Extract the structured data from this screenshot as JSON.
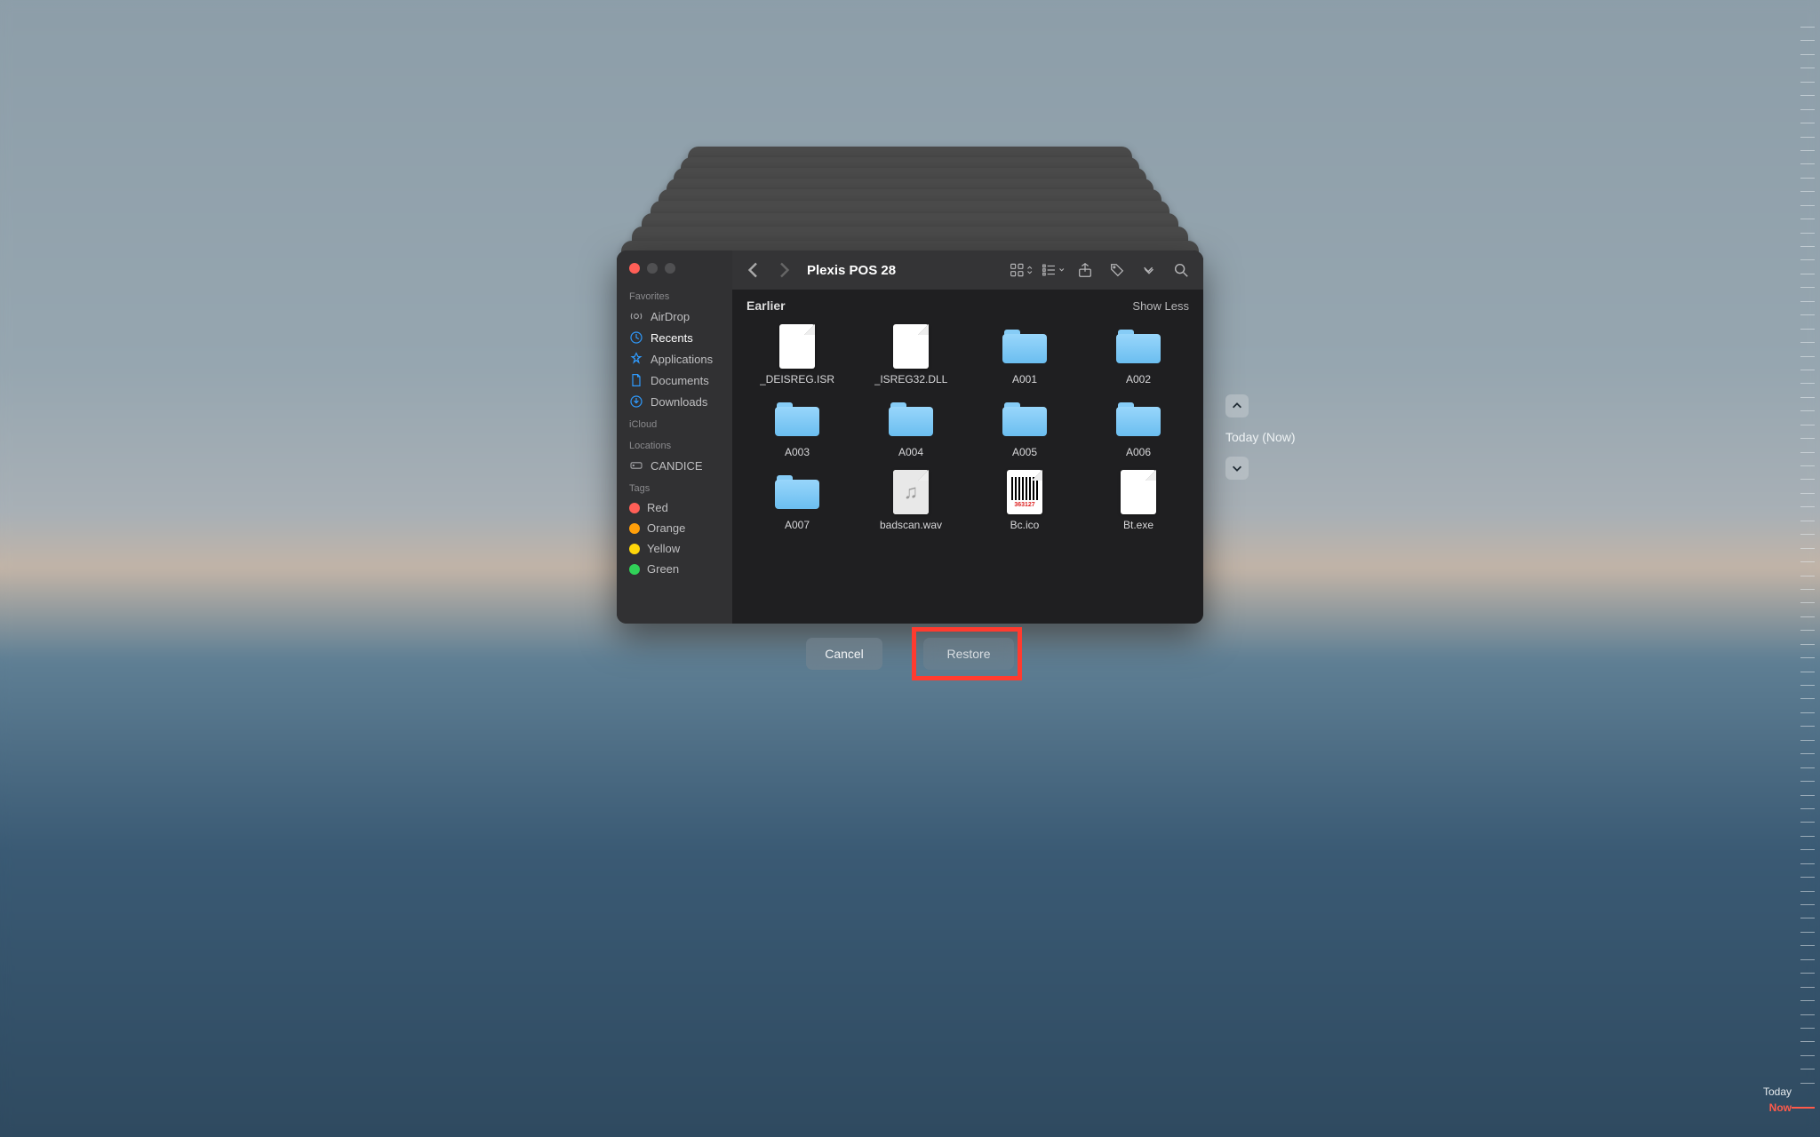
{
  "window": {
    "title": "Plexis POS 28"
  },
  "sidebar": {
    "sections": {
      "favorites": "Favorites",
      "icloud": "iCloud",
      "locations": "Locations",
      "tags": "Tags"
    },
    "favorites": [
      {
        "label": "AirDrop",
        "icon": "airdrop"
      },
      {
        "label": "Recents",
        "icon": "clock",
        "selected": true
      },
      {
        "label": "Applications",
        "icon": "apps"
      },
      {
        "label": "Documents",
        "icon": "doc"
      },
      {
        "label": "Downloads",
        "icon": "download"
      }
    ],
    "locations": [
      {
        "label": "CANDICE",
        "icon": "disk"
      }
    ],
    "tags": [
      {
        "label": "Red",
        "color": "#ff5f57"
      },
      {
        "label": "Orange",
        "color": "#ff9f0a"
      },
      {
        "label": "Yellow",
        "color": "#ffd60a"
      },
      {
        "label": "Green",
        "color": "#30d158"
      }
    ]
  },
  "content": {
    "section_title": "Earlier",
    "show_less": "Show Less",
    "files": [
      {
        "name": "_DEISREG.ISR",
        "kind": "doc"
      },
      {
        "name": "_ISREG32.DLL",
        "kind": "doc"
      },
      {
        "name": "A001",
        "kind": "folder"
      },
      {
        "name": "A002",
        "kind": "folder"
      },
      {
        "name": "A003",
        "kind": "folder"
      },
      {
        "name": "A004",
        "kind": "folder"
      },
      {
        "name": "A005",
        "kind": "folder"
      },
      {
        "name": "A006",
        "kind": "folder"
      },
      {
        "name": "A007",
        "kind": "folder"
      },
      {
        "name": "badscan.wav",
        "kind": "audio"
      },
      {
        "name": "Bc.ico",
        "kind": "barcode",
        "barcode_text": "363127"
      },
      {
        "name": "Bt.exe",
        "kind": "doc"
      }
    ]
  },
  "buttons": {
    "cancel": "Cancel",
    "restore": "Restore"
  },
  "timemachine": {
    "current_label": "Today (Now)",
    "timeline_today": "Today",
    "timeline_now": "Now"
  }
}
